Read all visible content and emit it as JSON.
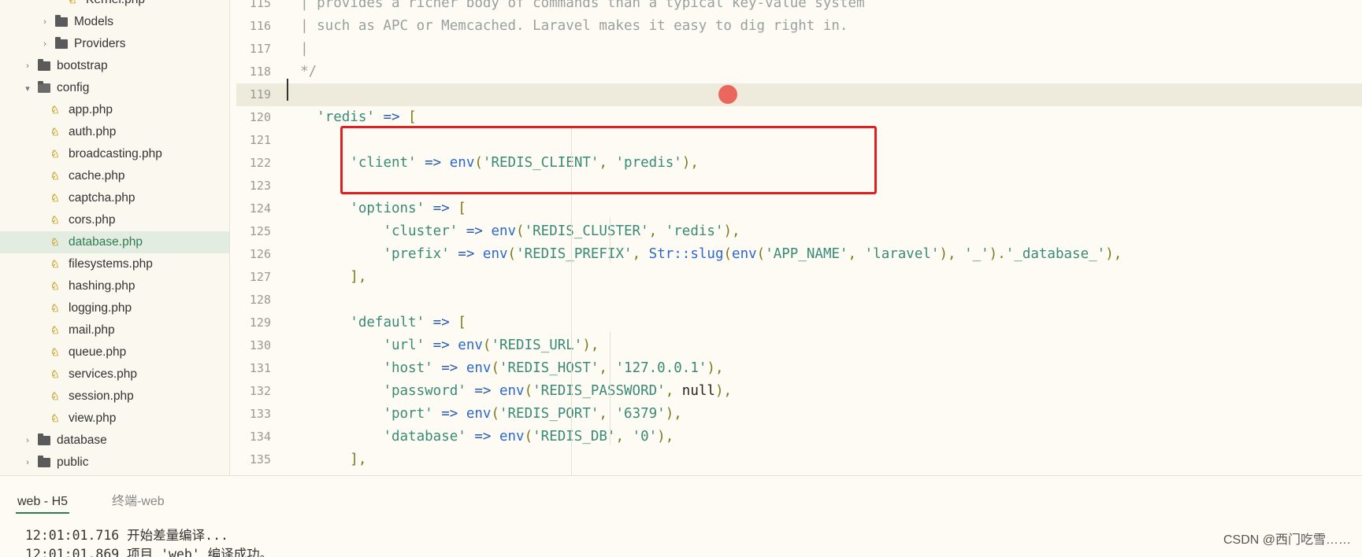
{
  "sidebar": {
    "items": [
      {
        "label": "Kernel.php",
        "type": "file",
        "depth": 4
      },
      {
        "label": "Models",
        "type": "folder",
        "expanded": false,
        "depth": 2
      },
      {
        "label": "Providers",
        "type": "folder",
        "expanded": false,
        "depth": 2
      },
      {
        "label": "bootstrap",
        "type": "folder",
        "expanded": false,
        "depth": 1
      },
      {
        "label": "config",
        "type": "folder",
        "expanded": true,
        "depth": 1
      },
      {
        "label": "app.php",
        "type": "file",
        "depth": 3
      },
      {
        "label": "auth.php",
        "type": "file",
        "depth": 3
      },
      {
        "label": "broadcasting.php",
        "type": "file",
        "depth": 3
      },
      {
        "label": "cache.php",
        "type": "file",
        "depth": 3
      },
      {
        "label": "captcha.php",
        "type": "file",
        "depth": 3
      },
      {
        "label": "cors.php",
        "type": "file",
        "depth": 3
      },
      {
        "label": "database.php",
        "type": "file",
        "depth": 3,
        "selected": true
      },
      {
        "label": "filesystems.php",
        "type": "file",
        "depth": 3
      },
      {
        "label": "hashing.php",
        "type": "file",
        "depth": 3
      },
      {
        "label": "logging.php",
        "type": "file",
        "depth": 3
      },
      {
        "label": "mail.php",
        "type": "file",
        "depth": 3
      },
      {
        "label": "queue.php",
        "type": "file",
        "depth": 3
      },
      {
        "label": "services.php",
        "type": "file",
        "depth": 3
      },
      {
        "label": "session.php",
        "type": "file",
        "depth": 3
      },
      {
        "label": "view.php",
        "type": "file",
        "depth": 3
      },
      {
        "label": "database",
        "type": "folder",
        "expanded": false,
        "depth": 1
      },
      {
        "label": "public",
        "type": "folder",
        "expanded": false,
        "depth": 1
      }
    ]
  },
  "editor": {
    "current_line": 119,
    "lines": [
      {
        "n": "115",
        "tokens": [
          [
            "c-comment",
            "  | provides a richer body of commands than a typical key-value system"
          ]
        ]
      },
      {
        "n": "116",
        "tokens": [
          [
            "c-comment",
            "  | such as APC or Memcached. Laravel makes it easy to dig right in."
          ]
        ]
      },
      {
        "n": "117",
        "tokens": [
          [
            "c-comment",
            "  |"
          ]
        ]
      },
      {
        "n": "118",
        "tokens": [
          [
            "c-comment",
            "  */"
          ]
        ]
      },
      {
        "n": "119",
        "tokens": []
      },
      {
        "n": "120",
        "tokens": [
          [
            "c-plain",
            "    "
          ],
          [
            "c-str",
            "'redis'"
          ],
          [
            "c-plain",
            " "
          ],
          [
            "c-op",
            "=>"
          ],
          [
            "c-plain",
            " "
          ],
          [
            "c-punc",
            "["
          ]
        ]
      },
      {
        "n": "121",
        "tokens": []
      },
      {
        "n": "122",
        "tokens": [
          [
            "c-plain",
            "        "
          ],
          [
            "c-str",
            "'client'"
          ],
          [
            "c-plain",
            " "
          ],
          [
            "c-op",
            "=>"
          ],
          [
            "c-plain",
            " "
          ],
          [
            "c-fn",
            "env"
          ],
          [
            "c-punc",
            "("
          ],
          [
            "c-str",
            "'REDIS_CLIENT'"
          ],
          [
            "c-punc",
            ", "
          ],
          [
            "c-str",
            "'predis'"
          ],
          [
            "c-punc",
            "),"
          ]
        ]
      },
      {
        "n": "123",
        "tokens": []
      },
      {
        "n": "124",
        "tokens": [
          [
            "c-plain",
            "        "
          ],
          [
            "c-str",
            "'options'"
          ],
          [
            "c-plain",
            " "
          ],
          [
            "c-op",
            "=>"
          ],
          [
            "c-plain",
            " "
          ],
          [
            "c-punc",
            "["
          ]
        ]
      },
      {
        "n": "125",
        "tokens": [
          [
            "c-plain",
            "            "
          ],
          [
            "c-str",
            "'cluster'"
          ],
          [
            "c-plain",
            " "
          ],
          [
            "c-op",
            "=>"
          ],
          [
            "c-plain",
            " "
          ],
          [
            "c-fn",
            "env"
          ],
          [
            "c-punc",
            "("
          ],
          [
            "c-str",
            "'REDIS_CLUSTER'"
          ],
          [
            "c-punc",
            ", "
          ],
          [
            "c-str",
            "'redis'"
          ],
          [
            "c-punc",
            "),"
          ]
        ]
      },
      {
        "n": "126",
        "tokens": [
          [
            "c-plain",
            "            "
          ],
          [
            "c-str",
            "'prefix'"
          ],
          [
            "c-plain",
            " "
          ],
          [
            "c-op",
            "=>"
          ],
          [
            "c-plain",
            " "
          ],
          [
            "c-fn",
            "env"
          ],
          [
            "c-punc",
            "("
          ],
          [
            "c-str",
            "'REDIS_PREFIX'"
          ],
          [
            "c-punc",
            ", "
          ],
          [
            "c-fn",
            "Str::slug"
          ],
          [
            "c-punc",
            "("
          ],
          [
            "c-fn",
            "env"
          ],
          [
            "c-punc",
            "("
          ],
          [
            "c-str",
            "'APP_NAME'"
          ],
          [
            "c-punc",
            ", "
          ],
          [
            "c-str",
            "'laravel'"
          ],
          [
            "c-punc",
            "), "
          ],
          [
            "c-str",
            "'_'"
          ],
          [
            "c-punc",
            ")."
          ],
          [
            "c-str",
            "'_database_'"
          ],
          [
            "c-punc",
            "),"
          ]
        ]
      },
      {
        "n": "127",
        "tokens": [
          [
            "c-plain",
            "        "
          ],
          [
            "c-punc",
            "],"
          ]
        ]
      },
      {
        "n": "128",
        "tokens": []
      },
      {
        "n": "129",
        "tokens": [
          [
            "c-plain",
            "        "
          ],
          [
            "c-str",
            "'default'"
          ],
          [
            "c-plain",
            " "
          ],
          [
            "c-op",
            "=>"
          ],
          [
            "c-plain",
            " "
          ],
          [
            "c-punc",
            "["
          ]
        ]
      },
      {
        "n": "130",
        "tokens": [
          [
            "c-plain",
            "            "
          ],
          [
            "c-str",
            "'url'"
          ],
          [
            "c-plain",
            " "
          ],
          [
            "c-op",
            "=>"
          ],
          [
            "c-plain",
            " "
          ],
          [
            "c-fn",
            "env"
          ],
          [
            "c-punc",
            "("
          ],
          [
            "c-str",
            "'REDIS_URL'"
          ],
          [
            "c-punc",
            "),"
          ]
        ]
      },
      {
        "n": "131",
        "tokens": [
          [
            "c-plain",
            "            "
          ],
          [
            "c-str",
            "'host'"
          ],
          [
            "c-plain",
            " "
          ],
          [
            "c-op",
            "=>"
          ],
          [
            "c-plain",
            " "
          ],
          [
            "c-fn",
            "env"
          ],
          [
            "c-punc",
            "("
          ],
          [
            "c-str",
            "'REDIS_HOST'"
          ],
          [
            "c-punc",
            ", "
          ],
          [
            "c-str",
            "'127.0.0.1'"
          ],
          [
            "c-punc",
            "),"
          ]
        ]
      },
      {
        "n": "132",
        "tokens": [
          [
            "c-plain",
            "            "
          ],
          [
            "c-str",
            "'password'"
          ],
          [
            "c-plain",
            " "
          ],
          [
            "c-op",
            "=>"
          ],
          [
            "c-plain",
            " "
          ],
          [
            "c-fn",
            "env"
          ],
          [
            "c-punc",
            "("
          ],
          [
            "c-str",
            "'REDIS_PASSWORD'"
          ],
          [
            "c-punc",
            ", "
          ],
          [
            "c-kw",
            "null"
          ],
          [
            "c-punc",
            "),"
          ]
        ]
      },
      {
        "n": "133",
        "tokens": [
          [
            "c-plain",
            "            "
          ],
          [
            "c-str",
            "'port'"
          ],
          [
            "c-plain",
            " "
          ],
          [
            "c-op",
            "=>"
          ],
          [
            "c-plain",
            " "
          ],
          [
            "c-fn",
            "env"
          ],
          [
            "c-punc",
            "("
          ],
          [
            "c-str",
            "'REDIS_PORT'"
          ],
          [
            "c-punc",
            ", "
          ],
          [
            "c-str",
            "'6379'"
          ],
          [
            "c-punc",
            "),"
          ]
        ]
      },
      {
        "n": "134",
        "tokens": [
          [
            "c-plain",
            "            "
          ],
          [
            "c-str",
            "'database'"
          ],
          [
            "c-plain",
            " "
          ],
          [
            "c-op",
            "=>"
          ],
          [
            "c-plain",
            " "
          ],
          [
            "c-fn",
            "env"
          ],
          [
            "c-punc",
            "("
          ],
          [
            "c-str",
            "'REDIS_DB'"
          ],
          [
            "c-punc",
            ", "
          ],
          [
            "c-str",
            "'0'"
          ],
          [
            "c-punc",
            "),"
          ]
        ]
      },
      {
        "n": "135",
        "tokens": [
          [
            "c-plain",
            "        "
          ],
          [
            "c-punc",
            "],"
          ]
        ]
      }
    ]
  },
  "bottom_panel": {
    "tabs": [
      {
        "label": "web - H5",
        "active": true
      },
      {
        "label": "终端-web",
        "active": false
      }
    ],
    "console": [
      "12:01:01.716 开始差量编译...",
      "12:01:01.869 项目 'web' 编译成功。"
    ]
  },
  "watermark": "CSDN @西门吃雪……",
  "colors": {
    "accent": "#2e7d52",
    "highlight_box": "#e02020",
    "string": "#3a8a78",
    "function": "#2b69c9"
  }
}
